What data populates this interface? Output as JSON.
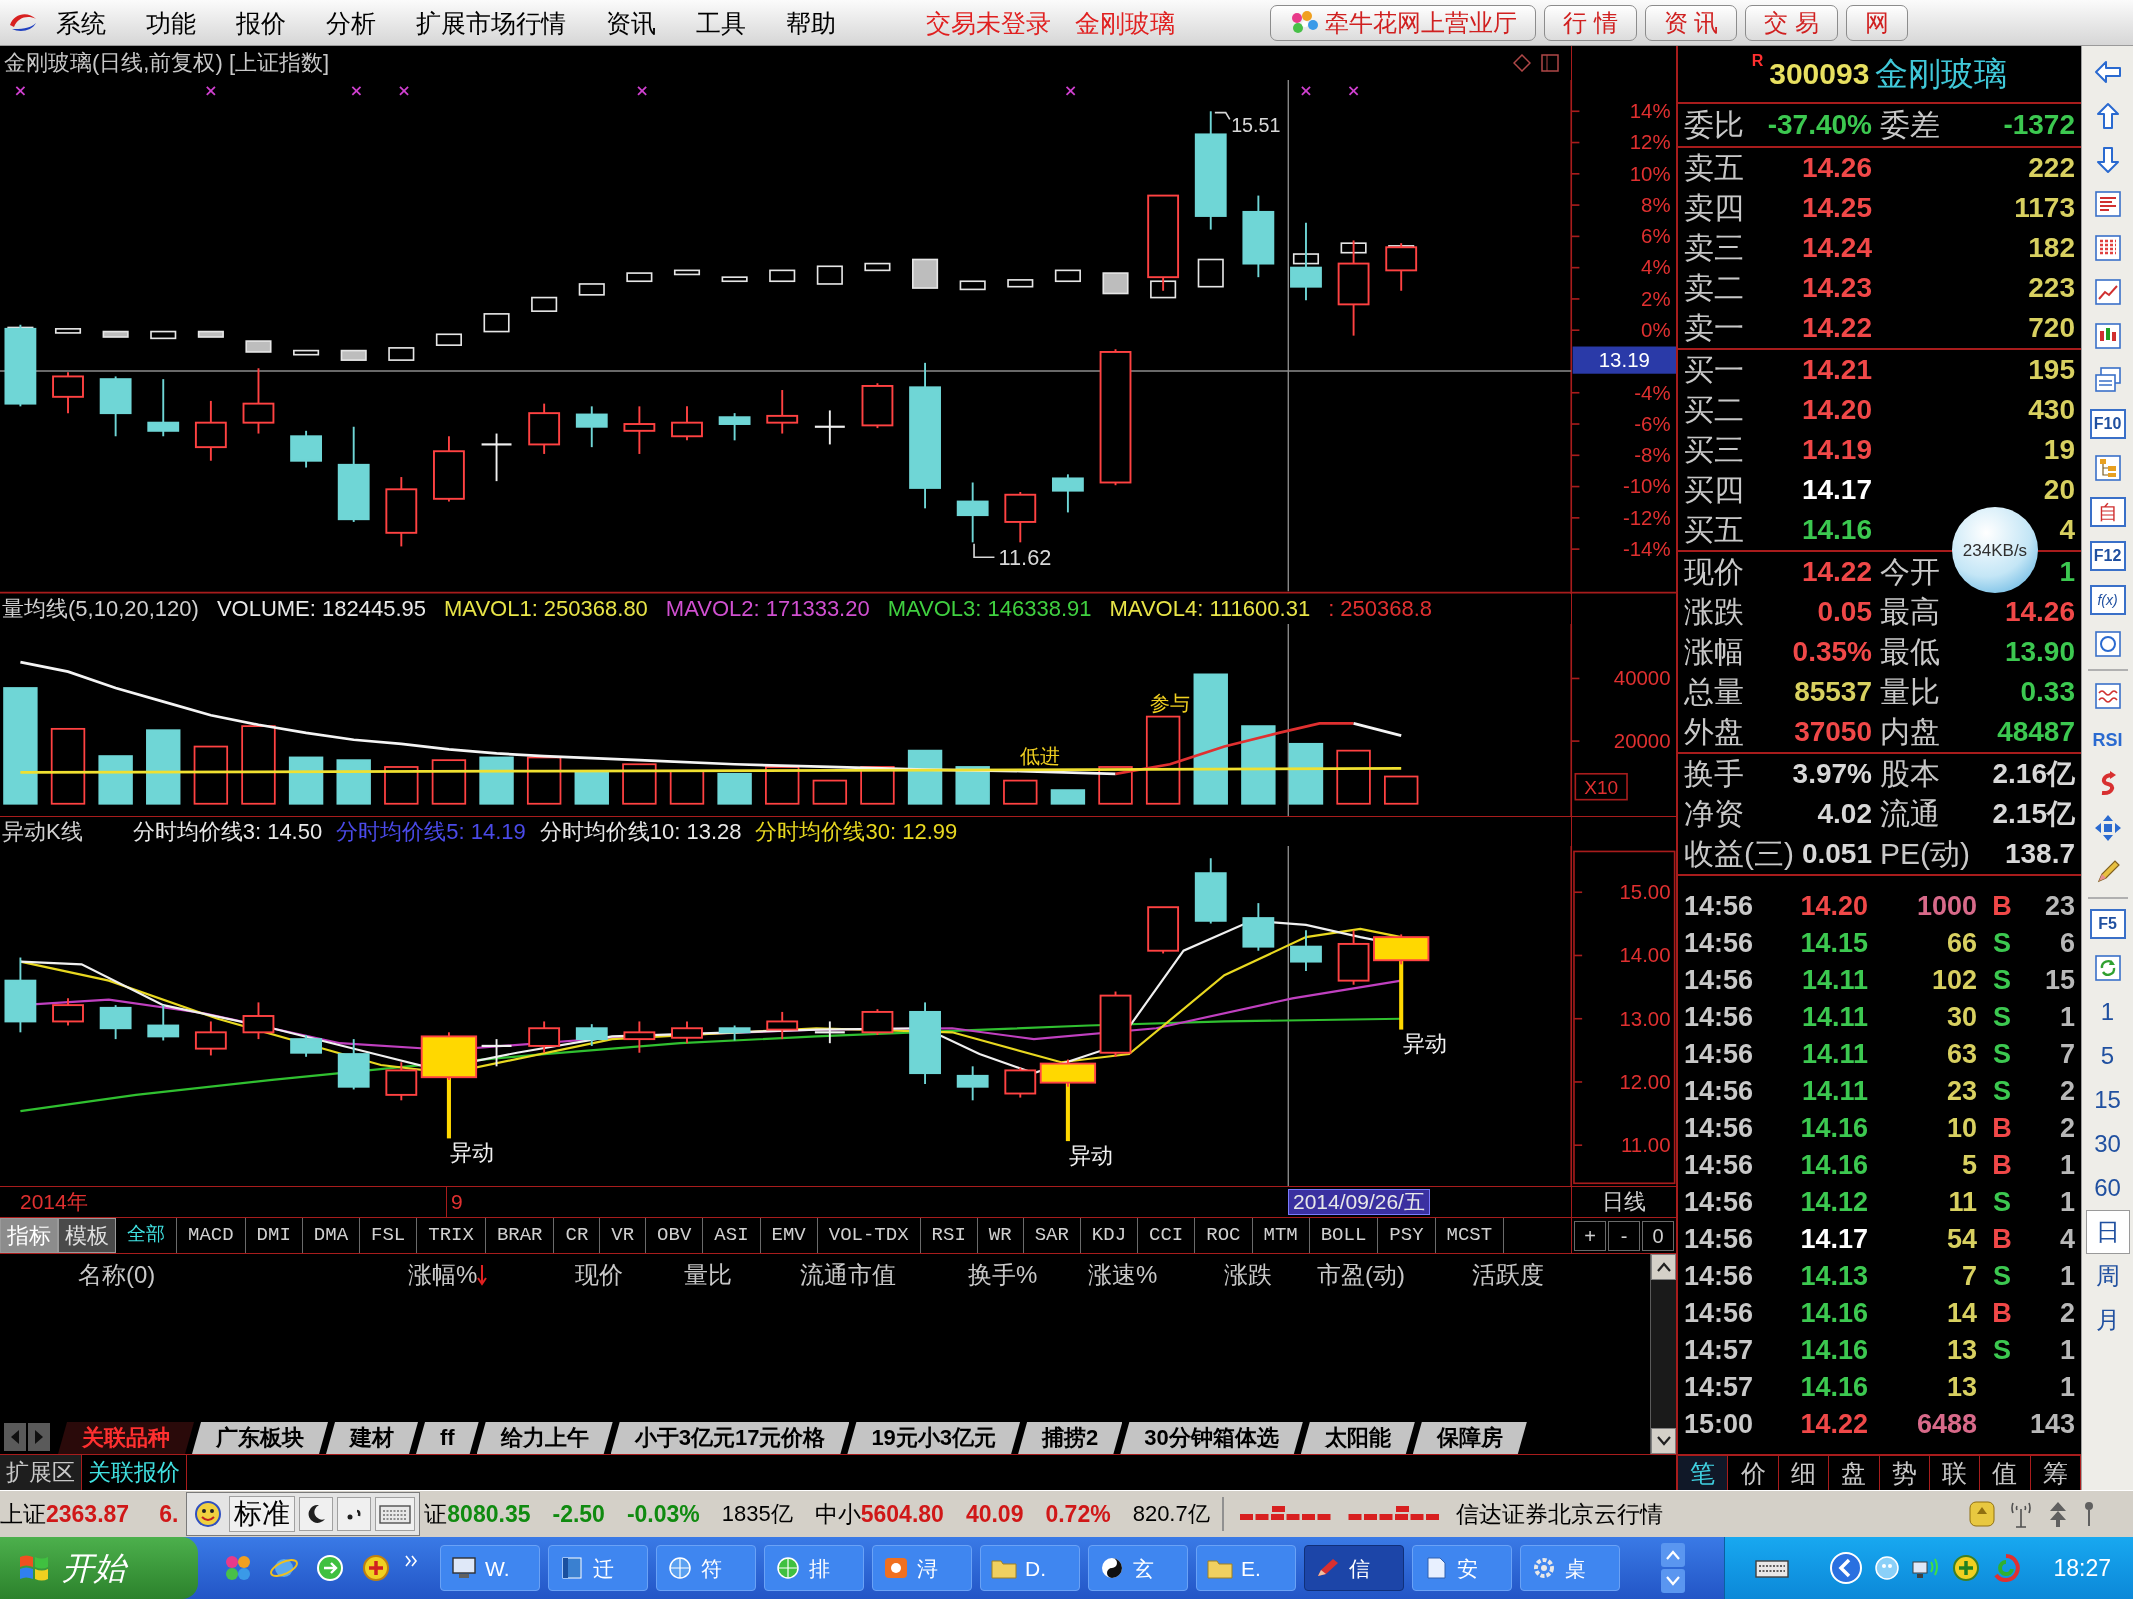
{
  "menu_bar": {
    "items": [
      "系统",
      "功能",
      "报价",
      "分析",
      "扩展市场行情",
      "资讯",
      "工具",
      "帮助"
    ],
    "notices": [
      "交易未登录",
      "金刚玻璃"
    ],
    "buttons": [
      "牵牛花网上营业厅",
      "行 情",
      "资 讯",
      "交 易",
      "网"
    ]
  },
  "price_chart": {
    "title": "金刚玻璃(日线,前复权) [上证指数]",
    "high_label": "15.51",
    "low_label": "11.62",
    "axis_upper": [
      "14%",
      "12%",
      "10%",
      "8%",
      "6%",
      "4%",
      "2%",
      "0%"
    ],
    "cursor_value": "13.19",
    "axis_lower": [
      "-4%",
      "-6%",
      "-8%",
      "-10%",
      "-12%",
      "-14%"
    ]
  },
  "volume_chart": {
    "title": "量均线(5,10,20,120)",
    "readings": [
      {
        "text": "VOLUME: 182445.95",
        "color": "#e8e8e8"
      },
      {
        "text": "MAVOL1: 250368.80",
        "color": "#e8e448"
      },
      {
        "text": "MAVOL2: 171333.20",
        "color": "#d050d0"
      },
      {
        "text": "MAVOL3: 146338.91",
        "color": "#40d040"
      },
      {
        "text": "MAVOL4: 111600.31",
        "color": "#e8e448"
      },
      {
        "text": ": 250368.8",
        "color": "#e03030"
      }
    ],
    "axis_labels": [
      "40000",
      "20000"
    ],
    "scale": "X10",
    "annotations": [
      "参与",
      "低进"
    ]
  },
  "signal_chart": {
    "title": "异动K线",
    "readings": [
      {
        "text": "分时均价线3: 14.50",
        "color": "#e8e8e8"
      },
      {
        "text": "分时均价线5: 14.19",
        "color": "#4a4ae8"
      },
      {
        "text": "分时均价线10: 13.28",
        "color": "#e8e8e8"
      },
      {
        "text": "分时均价线30: 12.99",
        "color": "#e8d820"
      }
    ],
    "axis_labels": [
      "15.00",
      "14.00",
      "13.00",
      "12.00",
      "11.00"
    ],
    "signal_labels": [
      "异动",
      "异动",
      "异动"
    ]
  },
  "date_axis": {
    "year": "2014年",
    "month": "9",
    "cursor_date": "2014/09/26/五",
    "period": "日线"
  },
  "indicator_bar": {
    "modes": [
      {
        "label": "指标",
        "selected": true
      },
      {
        "label": "模板",
        "selected": false
      }
    ],
    "tabs": [
      {
        "label": "全部",
        "selected": true
      },
      {
        "label": "MACD",
        "selected": false
      },
      {
        "label": "DMI",
        "selected": false
      },
      {
        "label": "DMA",
        "selected": false
      },
      {
        "label": "FSL",
        "selected": false
      },
      {
        "label": "TRIX",
        "selected": false
      },
      {
        "label": "BRAR",
        "selected": false
      },
      {
        "label": "CR",
        "selected": false
      },
      {
        "label": "VR",
        "selected": false
      },
      {
        "label": "OBV",
        "selected": false
      },
      {
        "label": "ASI",
        "selected": false
      },
      {
        "label": "EMV",
        "selected": false
      },
      {
        "label": "VOL-TDX",
        "selected": false
      },
      {
        "label": "RSI",
        "selected": false
      },
      {
        "label": "WR",
        "selected": false
      },
      {
        "label": "SAR",
        "selected": false
      },
      {
        "label": "KDJ",
        "selected": false
      },
      {
        "label": "CCI",
        "selected": false
      },
      {
        "label": "ROC",
        "selected": false
      },
      {
        "label": "MTM",
        "selected": false
      },
      {
        "label": "BOLL",
        "selected": false
      },
      {
        "label": "PSY",
        "selected": false
      },
      {
        "label": "MCST",
        "selected": false
      }
    ],
    "zoom_buttons": [
      "+",
      "-",
      "0"
    ]
  },
  "related_table": {
    "columns": [
      {
        "label": "名称(0)",
        "sorted": false
      },
      {
        "label": "涨幅%",
        "sorted": true
      },
      {
        "label": "现价",
        "sorted": false
      },
      {
        "label": "量比",
        "sorted": false
      },
      {
        "label": "流通市值",
        "sorted": false
      },
      {
        "label": "换手%",
        "sorted": false
      },
      {
        "label": "涨速%",
        "sorted": false
      },
      {
        "label": "涨跌",
        "sorted": false
      },
      {
        "label": "市盈(动)",
        "sorted": false
      },
      {
        "label": "活跃度",
        "sorted": false
      }
    ]
  },
  "sheet_tabs": [
    {
      "label": "关联品种",
      "selected": true
    },
    {
      "label": "广东板块",
      "selected": false
    },
    {
      "label": "建材",
      "selected": false
    },
    {
      "label": "ff",
      "selected": false
    },
    {
      "label": "给力上午",
      "selected": false
    },
    {
      "label": "小于3亿元17元价格",
      "selected": false
    },
    {
      "label": "19元小3亿元",
      "selected": false
    },
    {
      "label": "捕捞2",
      "selected": false
    },
    {
      "label": "30分钟箱体选",
      "selected": false
    },
    {
      "label": "太阳能",
      "selected": false
    },
    {
      "label": "保障房",
      "selected": false
    }
  ],
  "panel_tabs": [
    {
      "label": "扩展区",
      "selected": false
    },
    {
      "label": "关联报价",
      "selected": true
    }
  ],
  "quote": {
    "badge": "R",
    "code": "300093",
    "name": "金刚玻璃",
    "ratio": [
      {
        "label": "委比",
        "value": "-37.40%",
        "color": "#3cc850"
      },
      {
        "label": "委差",
        "value": "-1372",
        "color": "#3cc850"
      }
    ],
    "asks": [
      {
        "label": "卖五",
        "price": "14.26",
        "color": "#f04848",
        "volume": "222"
      },
      {
        "label": "卖四",
        "price": "14.25",
        "color": "#f04848",
        "volume": "1173"
      },
      {
        "label": "卖三",
        "price": "14.24",
        "color": "#f04848",
        "volume": "182"
      },
      {
        "label": "卖二",
        "price": "14.23",
        "color": "#f04848",
        "volume": "223"
      },
      {
        "label": "卖一",
        "price": "14.22",
        "color": "#f04848",
        "volume": "720"
      }
    ],
    "bids": [
      {
        "label": "买一",
        "price": "14.21",
        "color": "#f04848",
        "volume": "195"
      },
      {
        "label": "买二",
        "price": "14.20",
        "color": "#f04848",
        "volume": "430"
      },
      {
        "label": "买三",
        "price": "14.19",
        "color": "#f04848",
        "volume": "19"
      },
      {
        "label": "买四",
        "price": "14.17",
        "color": "#ffffff",
        "volume": "20"
      },
      {
        "label": "买五",
        "price": "14.16",
        "color": "#3cc850",
        "volume": "4"
      }
    ],
    "stats": [
      [
        {
          "label": "现价",
          "value": "14.22",
          "color": "#f04848"
        },
        {
          "label": "今开",
          "value": "1",
          "color": "#3cc850"
        }
      ],
      [
        {
          "label": "涨跌",
          "value": "0.05",
          "color": "#f04848"
        },
        {
          "label": "最高",
          "value": "14.26",
          "color": "#f04848"
        }
      ],
      [
        {
          "label": "涨幅",
          "value": "0.35%",
          "color": "#f04848"
        },
        {
          "label": "最低",
          "value": "13.90",
          "color": "#3cc850"
        }
      ],
      [
        {
          "label": "总量",
          "value": "85537",
          "color": "#d8d060"
        },
        {
          "label": "量比",
          "value": "0.33",
          "color": "#3cc850"
        }
      ],
      [
        {
          "label": "外盘",
          "value": "37050",
          "color": "#f04848"
        },
        {
          "label": "内盘",
          "value": "48487",
          "color": "#3cc850"
        }
      ]
    ],
    "fundamentals": [
      [
        {
          "label": "换手",
          "value": "3.97%"
        },
        {
          "label": "股本",
          "value": "2.16亿"
        }
      ],
      [
        {
          "label": "净资",
          "value": "4.02"
        },
        {
          "label": "流通",
          "value": "2.15亿"
        }
      ],
      [
        {
          "label": "收益(三)",
          "value": "0.051"
        },
        {
          "label": "PE(动)",
          "value": "138.7"
        }
      ]
    ]
  },
  "speed_indicator": "234KB/s",
  "trades": [
    {
      "time": "14:56",
      "price": {
        "value": "14.20",
        "color": "#f04848"
      },
      "volume": {
        "value": "1000",
        "color": "#d86a8a"
      },
      "side": {
        "value": "B",
        "color": "#f04848"
      },
      "count": "23"
    },
    {
      "time": "14:56",
      "price": {
        "value": "14.15",
        "color": "#3cc850"
      },
      "volume": {
        "value": "66",
        "color": "#d8d060"
      },
      "side": {
        "value": "S",
        "color": "#3cc850"
      },
      "count": "6"
    },
    {
      "time": "14:56",
      "price": {
        "value": "14.11",
        "color": "#3cc850"
      },
      "volume": {
        "value": "102",
        "color": "#d8d060"
      },
      "side": {
        "value": "S",
        "color": "#3cc850"
      },
      "count": "15"
    },
    {
      "time": "14:56",
      "price": {
        "value": "14.11",
        "color": "#3cc850"
      },
      "volume": {
        "value": "30",
        "color": "#d8d060"
      },
      "side": {
        "value": "S",
        "color": "#3cc850"
      },
      "count": "1"
    },
    {
      "time": "14:56",
      "price": {
        "value": "14.11",
        "color": "#3cc850"
      },
      "volume": {
        "value": "63",
        "color": "#d8d060"
      },
      "side": {
        "value": "S",
        "color": "#3cc850"
      },
      "count": "7"
    },
    {
      "time": "14:56",
      "price": {
        "value": "14.11",
        "color": "#3cc850"
      },
      "volume": {
        "value": "23",
        "color": "#d8d060"
      },
      "side": {
        "value": "S",
        "color": "#3cc850"
      },
      "count": "2"
    },
    {
      "time": "14:56",
      "price": {
        "value": "14.16",
        "color": "#3cc850"
      },
      "volume": {
        "value": "10",
        "color": "#d8d060"
      },
      "side": {
        "value": "B",
        "color": "#f04848"
      },
      "count": "2"
    },
    {
      "time": "14:56",
      "price": {
        "value": "14.16",
        "color": "#3cc850"
      },
      "volume": {
        "value": "5",
        "color": "#d8d060"
      },
      "side": {
        "value": "B",
        "color": "#f04848"
      },
      "count": "1"
    },
    {
      "time": "14:56",
      "price": {
        "value": "14.12",
        "color": "#3cc850"
      },
      "volume": {
        "value": "11",
        "color": "#d8d060"
      },
      "side": {
        "value": "S",
        "color": "#3cc850"
      },
      "count": "1"
    },
    {
      "time": "14:56",
      "price": {
        "value": "14.17",
        "color": "#ffffff"
      },
      "volume": {
        "value": "54",
        "color": "#d8d060"
      },
      "side": {
        "value": "B",
        "color": "#f04848"
      },
      "count": "4"
    },
    {
      "time": "14:56",
      "price": {
        "value": "14.13",
        "color": "#3cc850"
      },
      "volume": {
        "value": "7",
        "color": "#d8d060"
      },
      "side": {
        "value": "S",
        "color": "#3cc850"
      },
      "count": "1"
    },
    {
      "time": "14:56",
      "price": {
        "value": "14.16",
        "color": "#3cc850"
      },
      "volume": {
        "value": "14",
        "color": "#d8d060"
      },
      "side": {
        "value": "B",
        "color": "#f04848"
      },
      "count": "2"
    },
    {
      "time": "14:57",
      "price": {
        "value": "14.16",
        "color": "#3cc850"
      },
      "volume": {
        "value": "13",
        "color": "#d8d060"
      },
      "side": {
        "value": "S",
        "color": "#3cc850"
      },
      "count": "1"
    },
    {
      "time": "14:57",
      "price": {
        "value": "14.16",
        "color": "#3cc850"
      },
      "volume": {
        "value": "13",
        "color": "#d8d060"
      },
      "count": "1"
    },
    {
      "time": "15:00",
      "price": {
        "value": "14.22",
        "color": "#f04848"
      },
      "volume": {
        "value": "6488",
        "color": "#d86a8a"
      },
      "count": "143"
    }
  ],
  "detail_tabs": [
    {
      "label": "笔",
      "selected": true
    },
    {
      "label": "价",
      "selected": false
    },
    {
      "label": "细",
      "selected": false
    },
    {
      "label": "盘",
      "selected": false
    },
    {
      "label": "势",
      "selected": false
    },
    {
      "label": "联",
      "selected": false
    },
    {
      "label": "值",
      "selected": false
    },
    {
      "label": "筹",
      "selected": false
    }
  ],
  "toolbar": {
    "info_key": "F10",
    "watchlist_key": "自",
    "finance_key": "F12",
    "formula_key": "f(x)",
    "indicator_key": "RSI",
    "refresh_key": "F5",
    "periods": [
      {
        "label": "1",
        "selected": false
      },
      {
        "label": "5",
        "selected": false
      },
      {
        "label": "15",
        "selected": false
      },
      {
        "label": "30",
        "selected": false
      },
      {
        "label": "60",
        "selected": false
      },
      {
        "label": "日",
        "selected": true
      },
      {
        "label": "周",
        "selected": false
      },
      {
        "label": "月",
        "selected": false
      }
    ]
  },
  "status_bar": {
    "first": {
      "name": "上证",
      "value": "2363.87",
      "extra": "6.",
      "color": "#d01818"
    },
    "ime": {
      "mode": "标准"
    },
    "quotes": [
      {
        "name": "证",
        "value": "8080.35",
        "change": "-2.50",
        "percent": "-0.03%",
        "amount": "1835亿",
        "color": "#108a10"
      },
      {
        "name": "中小",
        "value": "5604.80",
        "change": "40.09",
        "percent": "0.72%",
        "amount": "820.7亿",
        "color": "#d01818"
      }
    ],
    "server": "信达证券北京云行情"
  },
  "taskbar": {
    "start": "开始",
    "tasks": [
      {
        "label": "W.",
        "selected": false
      },
      {
        "label": "迁",
        "selected": false
      },
      {
        "label": "符",
        "selected": false
      },
      {
        "label": "排",
        "selected": false
      },
      {
        "label": "浔",
        "selected": false
      },
      {
        "label": "D.",
        "selected": false
      },
      {
        "label": "玄",
        "selected": false
      },
      {
        "label": "E.",
        "selected": false
      },
      {
        "label": "信",
        "selected": true
      },
      {
        "label": "安",
        "selected": false
      },
      {
        "label": "桌",
        "selected": false
      }
    ],
    "clock": "18:27"
  }
}
